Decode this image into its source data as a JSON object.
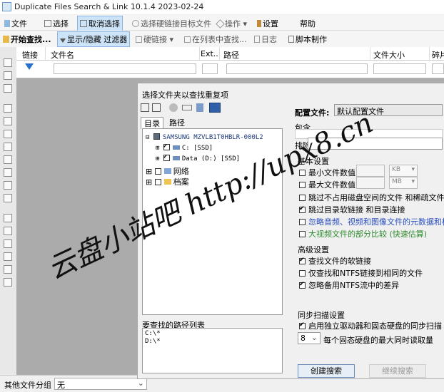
{
  "window": {
    "title": "Duplicate Files Search & Link 10.1.4 2023-02-24"
  },
  "menubar": {
    "items": [
      {
        "label": "文件",
        "icon": "file-icon"
      },
      {
        "label": "选择",
        "icon": "select-icon"
      },
      {
        "label": "取消选择",
        "icon": "deselect-icon"
      },
      {
        "label": "选择硬链接目标文件",
        "icon": "hardlink-target-icon"
      },
      {
        "label": "操作",
        "icon": "actions-icon"
      },
      {
        "label": "设置",
        "icon": "settings-icon"
      },
      {
        "label": "帮助",
        "icon": ""
      }
    ]
  },
  "toolbar": {
    "start_search": "开始查找...",
    "show_hide_filter": "显示/隐藏 过滤器",
    "hardlink": "硬链接",
    "find_in_list": "在列表中查找...",
    "log": "日志",
    "script": "脚本制作"
  },
  "grid": {
    "columns": [
      "链接",
      "文件名",
      "Ext...",
      "路径",
      "文件大小",
      "碎片"
    ]
  },
  "bottom": {
    "group_label": "其他文件分组",
    "group_value": "无"
  },
  "dialog": {
    "title": "选择文件夹以查找重复项",
    "tabs": [
      "目录",
      "路径"
    ],
    "tree": {
      "root": "SAMSUNG MZVLB1T0HBLR-000L2",
      "children": [
        {
          "label": "C: [SSD]",
          "checked": true
        },
        {
          "label": "Data (D:) [SSD]",
          "checked": true
        }
      ],
      "others": [
        {
          "label": "网络",
          "checked": false
        },
        {
          "label": "档案",
          "checked": false
        }
      ]
    },
    "paths_label": "要查找的路径列表",
    "paths": [
      "C:\\*",
      "D:\\*"
    ],
    "config_label": "配置文件:",
    "config_value": "默认配置文件",
    "include_label": "包含",
    "exclude_label": "排除",
    "basic_settings": "基本设置",
    "min_size_label": "最小文件数值",
    "max_size_label": "最大文件数值",
    "min_unit": "KB",
    "max_unit": "MB",
    "options_basic": [
      {
        "label": "跳过不占用磁盘空间的文件 和稀疏文件",
        "checked": false,
        "style": "normal"
      },
      {
        "label": "跳过目录软链接 和目录连接",
        "checked": true,
        "style": "normal"
      },
      {
        "label": "忽略音频、视频和图像文件的元数据和标签",
        "checked": false,
        "style": "blue"
      },
      {
        "label": "大视频文件的部分比较 (快速估算)",
        "checked": false,
        "style": "green"
      }
    ],
    "advanced_settings": "高级设置",
    "options_advanced": [
      {
        "label": "查找文件的软链接",
        "checked": true
      },
      {
        "label": "仅查找和NTFS链接到相同的文件",
        "checked": false
      },
      {
        "label": "忽略备用NTFS流中的差异",
        "checked": true
      }
    ],
    "sync_settings": "同步扫描设置",
    "sync_option": {
      "label": "启用独立驱动器和固态硬盘的同步扫描",
      "checked": true
    },
    "read_count_value": "8",
    "read_count_label": "每个固态硬盘的最大同时读取量",
    "create_search": "创建搜索",
    "continue_search": "继续搜索"
  },
  "watermark": {
    "text": "云盘小站吧 http://upx8.cn"
  },
  "colors": {
    "selection": "#cde3f7",
    "accent": "#2a4ec0",
    "green": "#2d8a2d",
    "dark_bg": "#ababab"
  }
}
